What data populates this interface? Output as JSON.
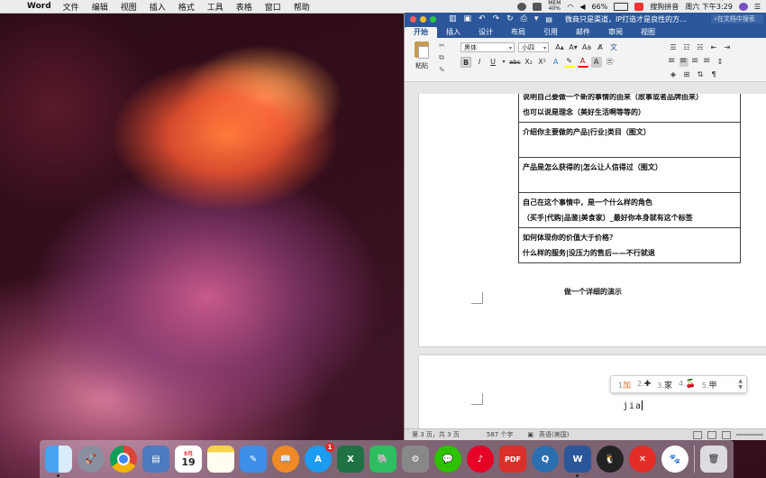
{
  "menubar": {
    "app_name": "Word",
    "items": [
      "文件",
      "编辑",
      "视图",
      "插入",
      "格式",
      "工具",
      "表格",
      "窗口",
      "帮助"
    ],
    "mem_label": "MEM",
    "mem_value": "40%",
    "battery": "66%",
    "ime_name": "搜狗拼音",
    "clock": "周六 下午3:29"
  },
  "word": {
    "doc_title": "微商只是渠道，IP打造才是良性的方...",
    "search_placeholder": "在文档中搜索",
    "tabs": [
      "开始",
      "插入",
      "设计",
      "布局",
      "引用",
      "邮件",
      "审阅",
      "视图"
    ],
    "ribbon": {
      "paste_label": "粘贴",
      "font_name": "黑体",
      "font_size": "小四",
      "bold": "B",
      "italic": "I",
      "underline": "U",
      "strike": "abc",
      "subscript": "X₂",
      "superscript": "X²"
    },
    "table_rows": [
      {
        "line1": "说明自己要做一个新的事情的由来（故事或者品牌由来）",
        "line2": "也可以说是理念（美好生活啊等等的）"
      },
      {
        "line1": "介绍你主要做的产品|行业|类目（图文）",
        "line2": ""
      },
      {
        "line1": "产品是怎么获得的|怎么让人信得过（图文）",
        "line2": ""
      },
      {
        "line1": "自己在这个事情中，是一个什么样的角色",
        "line2": "（买手|代购|品鉴|美食家）_最好你本身就有这个标签"
      },
      {
        "line1": "如何体现你的价值大于价格？",
        "line2": "什么样的服务|没压力的售后——不行就退"
      }
    ],
    "heading": "做一个详细的演示",
    "ime": {
      "candidates": [
        {
          "num": "1",
          "text": "加"
        },
        {
          "num": "2.",
          "text": "✚"
        },
        {
          "num": "3.",
          "text": "家"
        },
        {
          "num": "4.",
          "text": "🍒"
        },
        {
          "num": "5.",
          "text": "甲"
        }
      ],
      "input": "jia"
    },
    "status": {
      "page": "第 3 页，共 3 页",
      "words": "587 个字",
      "language": "英语(美国)"
    }
  },
  "dock": {
    "calendar_month": "9月",
    "calendar_day": "19",
    "appstore_badge": "1",
    "excel_letter": "X",
    "word_letter": "W",
    "pdf_label": "PDF"
  },
  "colors": {
    "word_blue": "#2b579a",
    "ribbon_bg": "#f3f3f3",
    "ime_highlight": "#e06a1a"
  }
}
